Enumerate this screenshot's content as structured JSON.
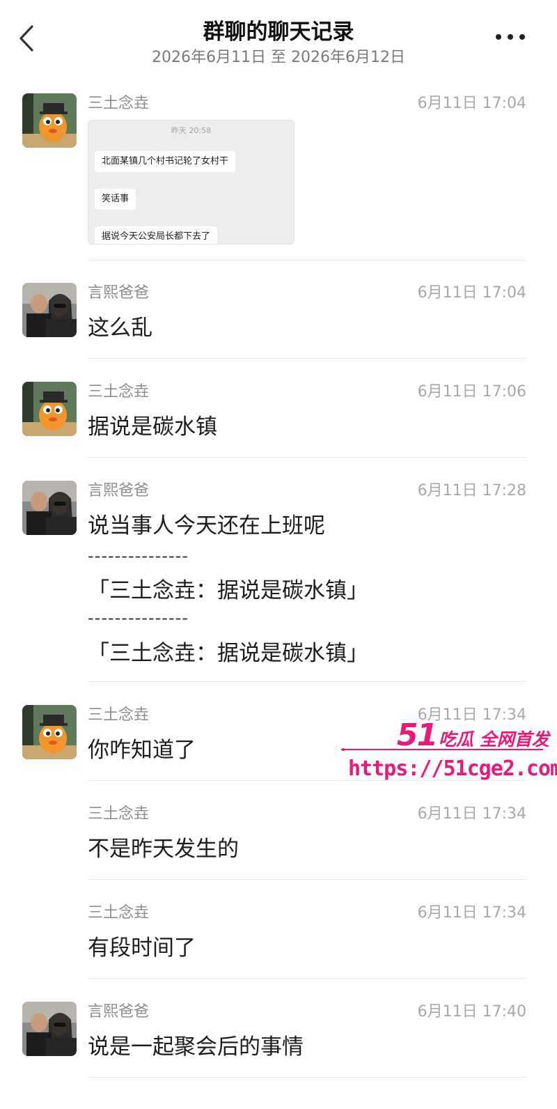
{
  "header": {
    "title": "群聊的聊天记录",
    "subtitle": "2026年6月11日 至 2026年6月12日"
  },
  "messages": [
    {
      "sender": "三土念垚",
      "time": "6月11日 17:04",
      "text": "",
      "avatar": "orange-mascot"
    },
    {
      "sender": "言熙爸爸",
      "time": "6月11日 17:04",
      "text": "这么乱",
      "avatar": "couple-photo"
    },
    {
      "sender": "三土念垚",
      "time": "6月11日 17:06",
      "text": "据说是碳水镇",
      "avatar": "orange-mascot"
    },
    {
      "sender": "言熙爸爸",
      "time": "6月11日 17:28",
      "text": "说当事人今天还在上班呢",
      "avatar": "couple-photo"
    },
    {
      "sender": "三土念垚",
      "time": "6月11日 17:34",
      "text": "你咋知道了",
      "avatar": "orange-mascot"
    },
    {
      "sender": "三土念垚",
      "time": "6月11日 17:34",
      "text": "不是昨天发生的",
      "avatar": ""
    },
    {
      "sender": "三土念垚",
      "time": "6月11日 17:34",
      "text": "有段时间了",
      "avatar": ""
    },
    {
      "sender": "言熙爸爸",
      "time": "6月11日 17:40",
      "text": "说是一起聚会后的事情",
      "avatar": "couple-photo"
    }
  ],
  "screenshot": {
    "time": "昨天 20:58",
    "bubbles": [
      "北面某镇几个村书记轮了女村干",
      "笑话事",
      "据说今天公安局长都下去了"
    ]
  },
  "quotes": {
    "separator": "---------------",
    "items": [
      "「三土念垚：据说是碳水镇」",
      "「三土念垚：据说是碳水镇」"
    ]
  },
  "watermark": {
    "brand": "51",
    "tag": "吃瓜 全网首发",
    "url": "https://51cge2.com",
    "color": "#e8197a"
  }
}
